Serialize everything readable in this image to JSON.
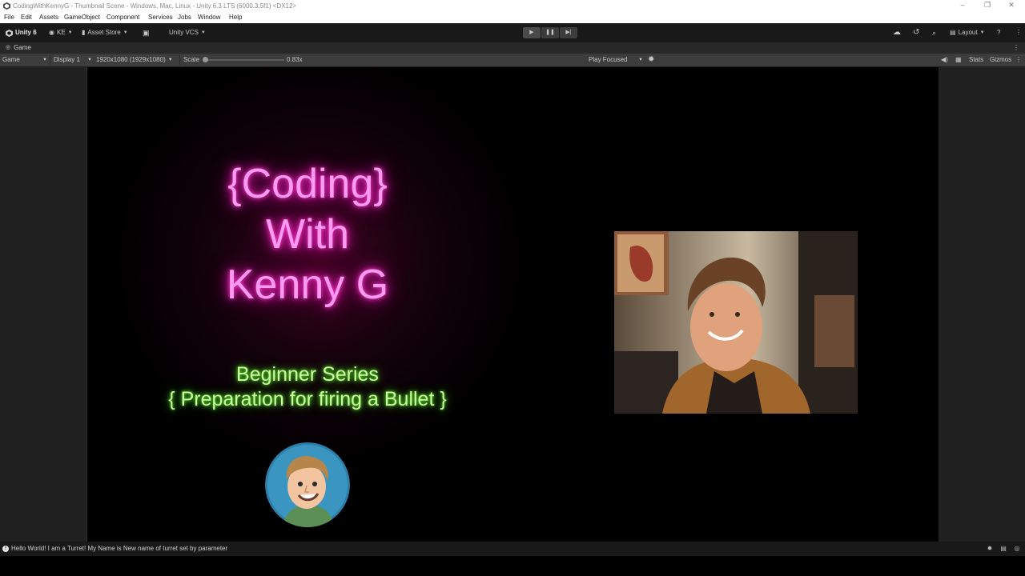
{
  "window": {
    "title": "CodingWithKennyG - Thumbnail Scene - Windows, Mac, Linux - Unity 6.3 LTS (6000.3.5f1) <DX12>"
  },
  "menu": [
    "File",
    "Edit",
    "Assets",
    "GameObject",
    "Component",
    "Services",
    "Jobs",
    "Window",
    "Help"
  ],
  "toolbar": {
    "unity_label": "Unity 6",
    "account_label": "KE",
    "asset_store_label": "Asset Store",
    "vcs_label": "Unity VCS",
    "layout_label": "Layout"
  },
  "tab": {
    "label": "Game"
  },
  "gamebar": {
    "view_select": "Game",
    "display_select": "Display 1",
    "resolution_select": "1920x1080 (1929x1080)",
    "scale_label": "Scale",
    "scale_value": "0.83x",
    "scale_level": 0.0,
    "play_mode_select": "Play Focused",
    "stats_label": "Stats",
    "gizmos_label": "Gizmos"
  },
  "scene": {
    "title_line1": "{Coding}",
    "title_line2": "With",
    "title_line3": "Kenny G",
    "series_line1": "Beginner Series",
    "series_line2": "{ Preparation for firing a Bullet }"
  },
  "status": {
    "message": "Hello World! I am a Turret! My Name is New name of turret set by parameter"
  },
  "colors": {
    "neon_pink": "#ff9af0",
    "neon_green": "#c8ff9a",
    "editor_dark": "#191919"
  }
}
